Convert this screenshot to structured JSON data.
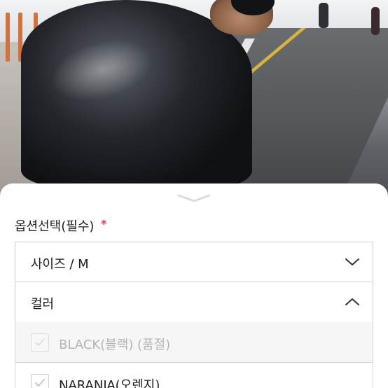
{
  "photo": {
    "icon": "product-photo-cyclist-jacket"
  },
  "sheet": {
    "handle_icon": "chevron-down-icon",
    "section_label": "옵션선택(필수)",
    "required_mark": "*",
    "size_select": {
      "label": "사이즈 / M",
      "icon": "chevron-down-icon"
    },
    "color_select": {
      "label": "컬러",
      "icon": "chevron-up-icon",
      "options": [
        {
          "label": "BLACK(블랙) (품절)",
          "disabled": true
        },
        {
          "label": "NARANJA(오렌지)",
          "disabled": false
        }
      ]
    }
  },
  "colors": {
    "required": "#e8344e",
    "border": "#cfcfcf",
    "disabled_text": "#b4b4b4",
    "panel_bg": "#f6f6f6"
  }
}
